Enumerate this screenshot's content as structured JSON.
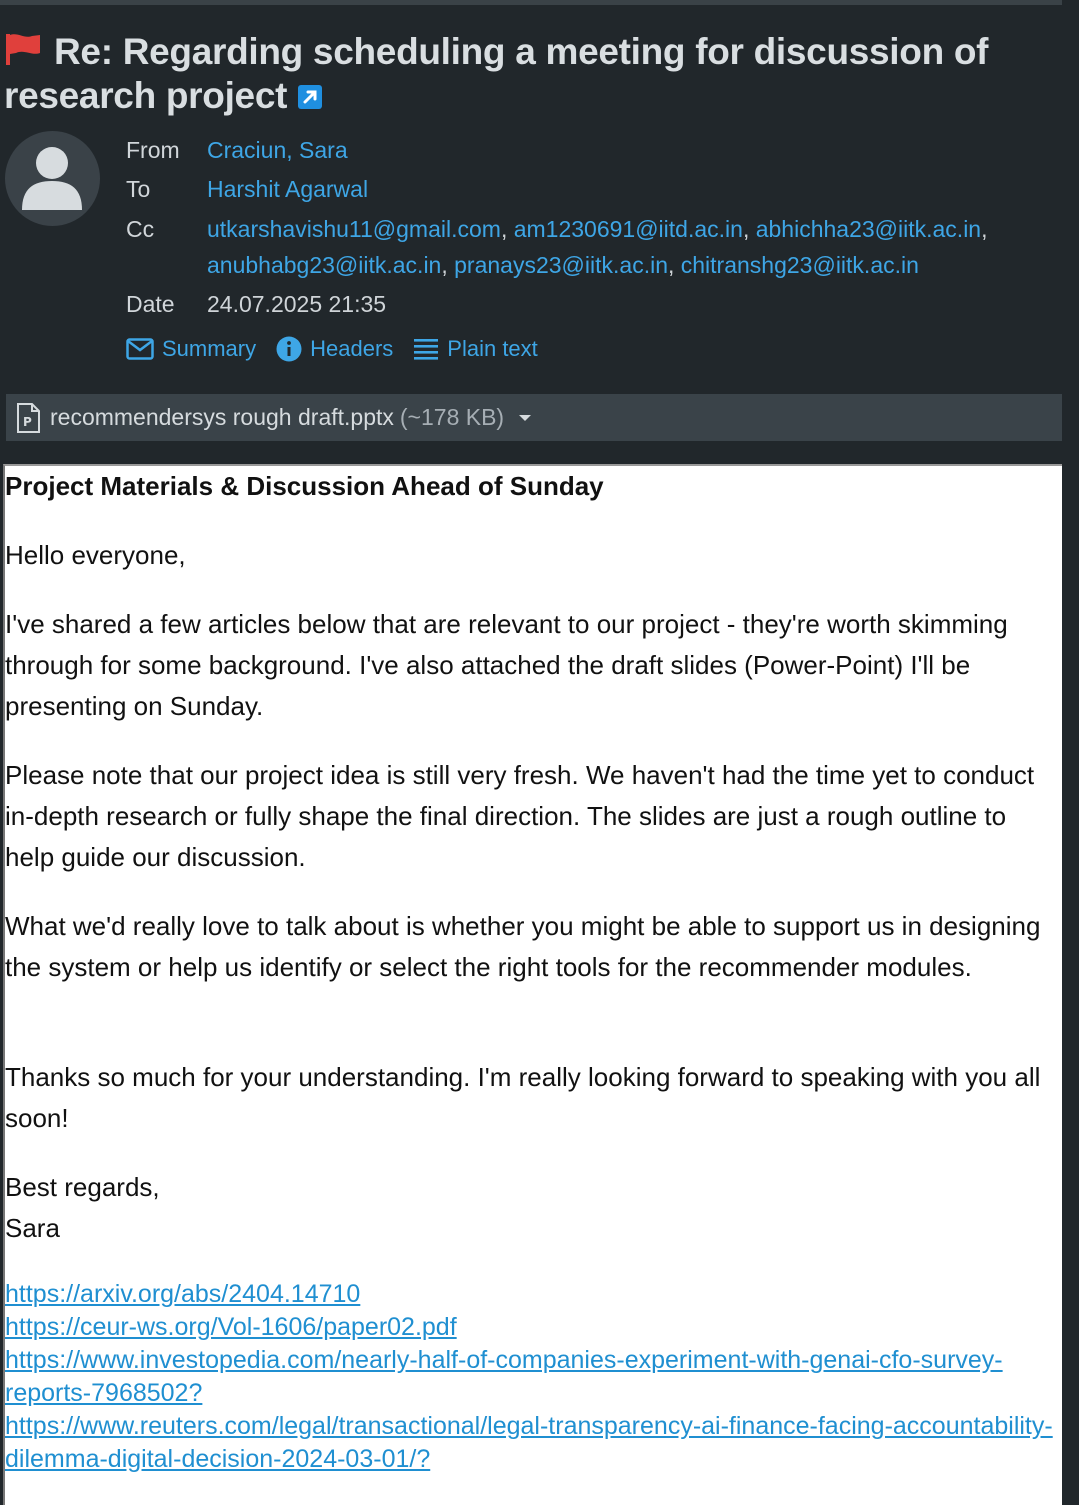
{
  "subject": "Re: Regarding scheduling a meeting for discussion of research project",
  "headers": {
    "from_label": "From",
    "from_value": "Craciun, Sara",
    "to_label": "To",
    "to_value": "Harshit Agarwal",
    "cc_label": "Cc",
    "cc_values": [
      "utkarshavishu11@gmail.com",
      "am1230691@iitd.ac.in",
      "abhichha23@iitk.ac.in",
      "anubhabg23@iitk.ac.in",
      "pranays23@iitk.ac.in",
      "chitranshg23@iitk.ac.in"
    ],
    "date_label": "Date",
    "date_value": "24.07.2025 21:35"
  },
  "actions": {
    "summary": "Summary",
    "headers": "Headers",
    "plain_text": "Plain text"
  },
  "attachment": {
    "name": "recommendersys rough draft.pptx",
    "size": "(~178 KB)"
  },
  "body": {
    "title": "Project Materials & Discussion Ahead of Sunday",
    "greeting": "Hello everyone,",
    "p1": "I've shared a few articles below that are relevant to our project - they're worth skimming through for some background. I've also attached the draft slides (Power-Point)  I'll be presenting on Sunday.",
    "p2": "Please note that our project idea is still very fresh. We haven't had the time yet to conduct in-depth research or fully shape the final direction. The slides are just a rough outline to help guide our discussion.",
    "p3": "What we'd really love to talk about is whether you might be able to support us in designing the system or help us identify or select the right tools for the recommender modules.",
    "p4": "Thanks so much for your understanding. I'm really looking forward to speaking with you all soon!",
    "closing": "Best regards,",
    "signature": "Sara",
    "links": [
      "https://arxiv.org/abs/2404.14710",
      "https://ceur-ws.org/Vol-1606/paper02.pdf",
      "https://www.investopedia.com/nearly-half-of-companies-experiment-with-genai-cfo-survey-reports-7968502?",
      "https://www.reuters.com/legal/transactional/legal-transparency-ai-finance-facing-accountability-dilemma-digital-decision-2024-03-01/?"
    ]
  },
  "colors": {
    "background": "#21272b",
    "link": "#3ea6e6",
    "flag": "#e0403c"
  }
}
